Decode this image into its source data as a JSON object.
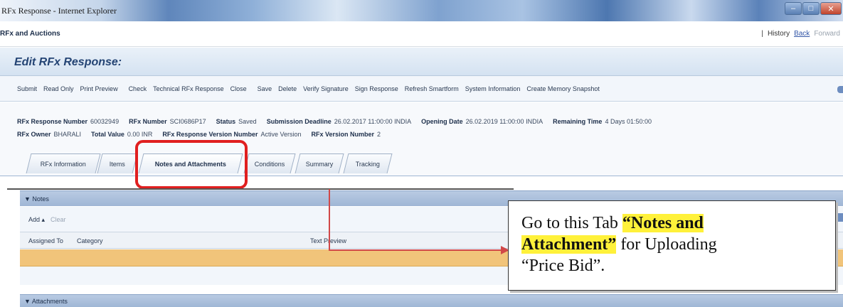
{
  "window": {
    "title": "RFx Response - Internet Explorer",
    "buttons": [
      "–",
      "□",
      "✕"
    ]
  },
  "app": {
    "name": "RFx and Auctions",
    "history": "History",
    "back": "Back",
    "forward": "Forward"
  },
  "page": {
    "title": "Edit RFx Response:"
  },
  "toolbar": [
    "Submit",
    "Read Only",
    "Print Preview",
    "Check",
    "Technical RFx Response",
    "Close",
    "Save",
    "Delete",
    "Verify Signature",
    "Sign Response",
    "Refresh Smartform",
    "System Information",
    "Create Memory Snapshot"
  ],
  "header": {
    "row1": [
      {
        "label": "RFx Response Number",
        "value": "60032949"
      },
      {
        "label": "RFx Number",
        "value": "SCI0686P17"
      },
      {
        "label": "Status",
        "value": "Saved"
      },
      {
        "label": "Submission Deadline",
        "value": "26.02.2017 11:00:00 INDIA"
      },
      {
        "label": "Opening Date",
        "value": "26.02.2019 11:00:00 INDIA"
      },
      {
        "label": "Remaining Time",
        "value": "4 Days 01:50:00"
      }
    ],
    "row2": [
      {
        "label": "RFx Owner",
        "value": "BHARALI"
      },
      {
        "label": "Total Value",
        "value": "0.00 INR"
      },
      {
        "label": "RFx Response Version Number",
        "value": "Active Version"
      },
      {
        "label": "RFx Version Number",
        "value": "2"
      }
    ]
  },
  "tabs": [
    "RFx Information",
    "Items",
    "Notes and Attachments",
    "Conditions",
    "Summary",
    "Tracking"
  ],
  "active_tab": "Notes and Attachments",
  "notes": {
    "title": "▼ Notes",
    "add": "Add ▴",
    "clear": "Clear",
    "columns": [
      "Assigned To",
      "Category",
      "Text Preview"
    ]
  },
  "attachments": {
    "title": "▼ Attachments"
  },
  "callout": {
    "pre": "Go to this Tab ",
    "highlight1": "“Notes and",
    "highlight2": "Attachment”",
    "post1": " for Uploading",
    "post2": "“Price Bid”."
  }
}
